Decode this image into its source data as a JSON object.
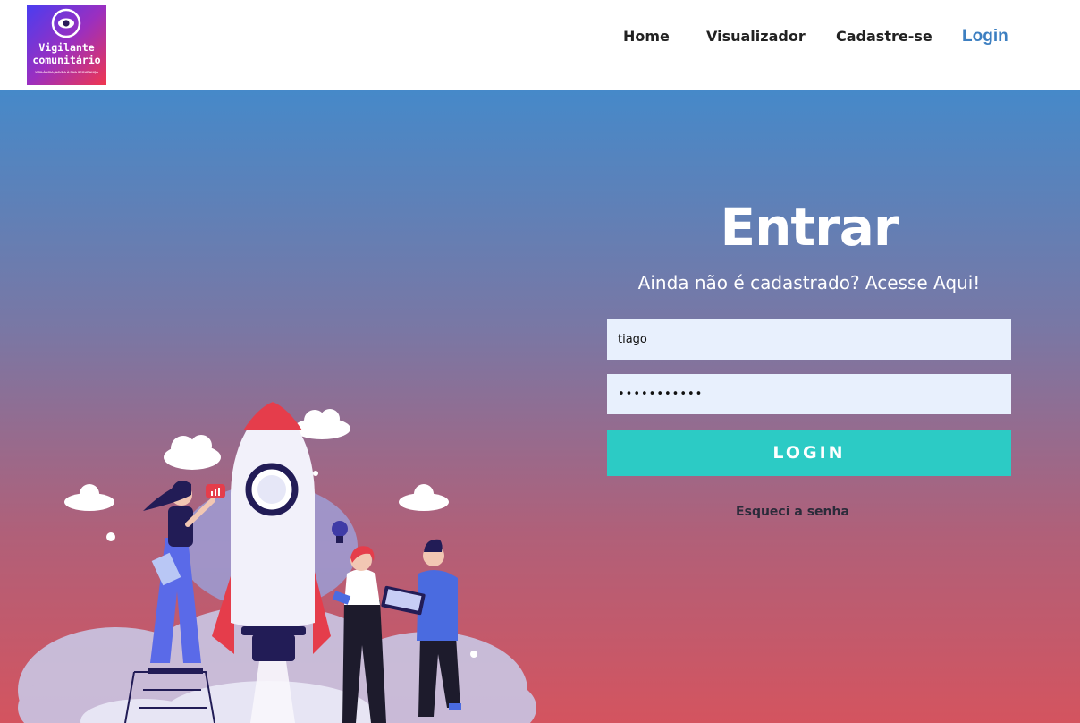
{
  "header": {
    "logo": {
      "line1": "Vigilante",
      "line2": "comunitário",
      "tagline": "VIGILÂNCIA, AJUDA À SUA SEGURANÇA"
    },
    "nav": [
      {
        "label": "Home"
      },
      {
        "label": "Visualizador"
      },
      {
        "label": "Cadastre-se"
      },
      {
        "label": "Login",
        "active": true
      }
    ]
  },
  "login": {
    "title": "Entrar",
    "subtitle": "Ainda não é cadastrado? Acesse Aqui!",
    "username_value": "tiago",
    "password_value": "•••••••••••",
    "button_label": "LOGIN",
    "forgot_label": "Esqueci a senha"
  },
  "colors": {
    "accent": "#2ccbc5",
    "nav_active": "#3d7fc1",
    "field_bg": "#e8f0fd",
    "gradient_top": "#4689c9",
    "gradient_bottom": "#d4545f"
  },
  "icons": [
    "eye-icon",
    "rocket-illustration",
    "lightbulb-icon",
    "chart-bubble-icon"
  ]
}
